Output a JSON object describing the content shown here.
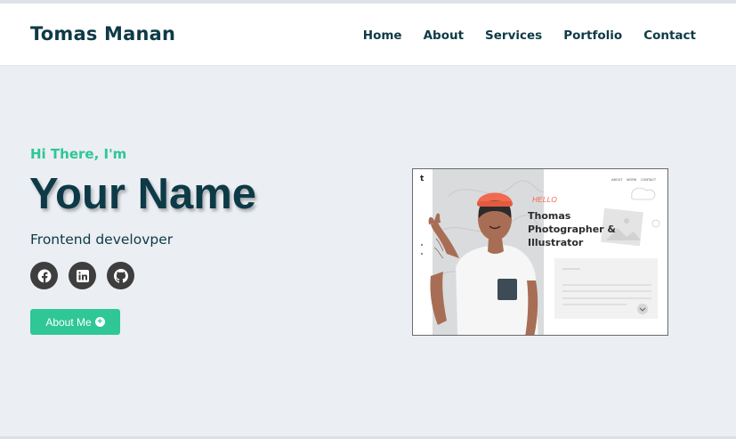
{
  "header": {
    "brand": "Tomas Manan",
    "nav": [
      "Home",
      "About",
      "Services",
      "Portfolio",
      "Contact"
    ]
  },
  "hero": {
    "greeting": "Hi There, I'm",
    "name": "Your Name",
    "role": "Frontend develovper",
    "socials": [
      "facebook-icon",
      "linkedin-icon",
      "github-icon"
    ],
    "about_button": "About Me"
  },
  "illustration": {
    "logo_letter": "t",
    "menu": [
      "ABOUT",
      "WORK",
      "CONTACT"
    ],
    "hello": "HELLO",
    "title_line1": "Thomas",
    "title_line2": "Photographer &",
    "title_line3": "Illustrator"
  },
  "colors": {
    "accent": "#2ec795",
    "dark": "#0e3a47",
    "background": "#ebeef2"
  }
}
